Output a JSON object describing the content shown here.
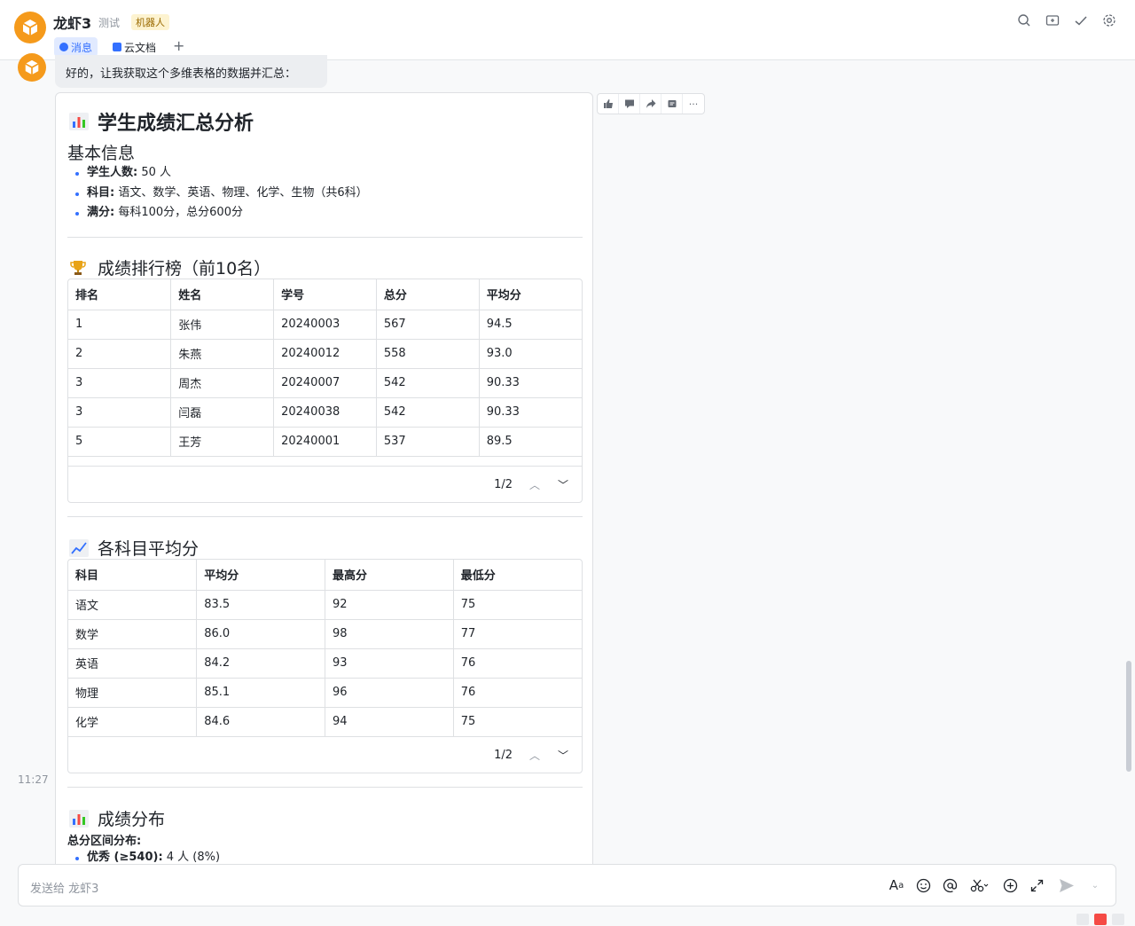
{
  "header": {
    "title": "龙虾3",
    "subtitle": "测试",
    "tag": "机器人",
    "tabs": [
      {
        "label": "消息"
      },
      {
        "label": "云文档"
      }
    ],
    "add_tab": "+"
  },
  "chat": {
    "intro_text": "好的，让我获取这个多维表格的数据并汇总：",
    "time": "11:27"
  },
  "report": {
    "title": "学生成绩汇总分析",
    "basic": {
      "heading": "基本信息",
      "items": [
        {
          "label": "学生人数:",
          "value": " 50 人"
        },
        {
          "label": "科目:",
          "value": " 语文、数学、英语、物理、化学、生物（共6科）"
        },
        {
          "label": "满分:",
          "value": " 每科100分，总分600分"
        }
      ]
    },
    "ranking": {
      "heading": "成绩排行榜（前10名）",
      "headers": [
        "排名",
        "姓名",
        "学号",
        "总分",
        "平均分"
      ],
      "rows": [
        [
          "1",
          "张伟",
          "20240003",
          "567",
          "94.5"
        ],
        [
          "2",
          "朱燕",
          "20240012",
          "558",
          "93.0"
        ],
        [
          "3",
          "周杰",
          "20240007",
          "542",
          "90.33"
        ],
        [
          "3",
          "闫磊",
          "20240038",
          "542",
          "90.33"
        ],
        [
          "5",
          "王芳",
          "20240001",
          "537",
          "89.5"
        ]
      ],
      "page": "1/2"
    },
    "subjects": {
      "heading": "各科目平均分",
      "headers": [
        "科目",
        "平均分",
        "最高分",
        "最低分"
      ],
      "rows": [
        [
          "语文",
          "83.5",
          "92",
          "75"
        ],
        [
          "数学",
          "86.0",
          "98",
          "77"
        ],
        [
          "英语",
          "84.2",
          "93",
          "76"
        ],
        [
          "物理",
          "85.1",
          "96",
          "76"
        ],
        [
          "化学",
          "84.6",
          "94",
          "75"
        ]
      ],
      "page": "1/2"
    },
    "distribution": {
      "heading": "成绩分布",
      "subheading": "总分区间分布:",
      "items": [
        {
          "label": "优秀 (≥540):",
          "value": " 4 人 (8%)"
        }
      ]
    }
  },
  "input": {
    "placeholder": "发送给 龙虾3"
  },
  "colors": {
    "accent": "#3370ff",
    "avatar": "#f59a1b"
  }
}
